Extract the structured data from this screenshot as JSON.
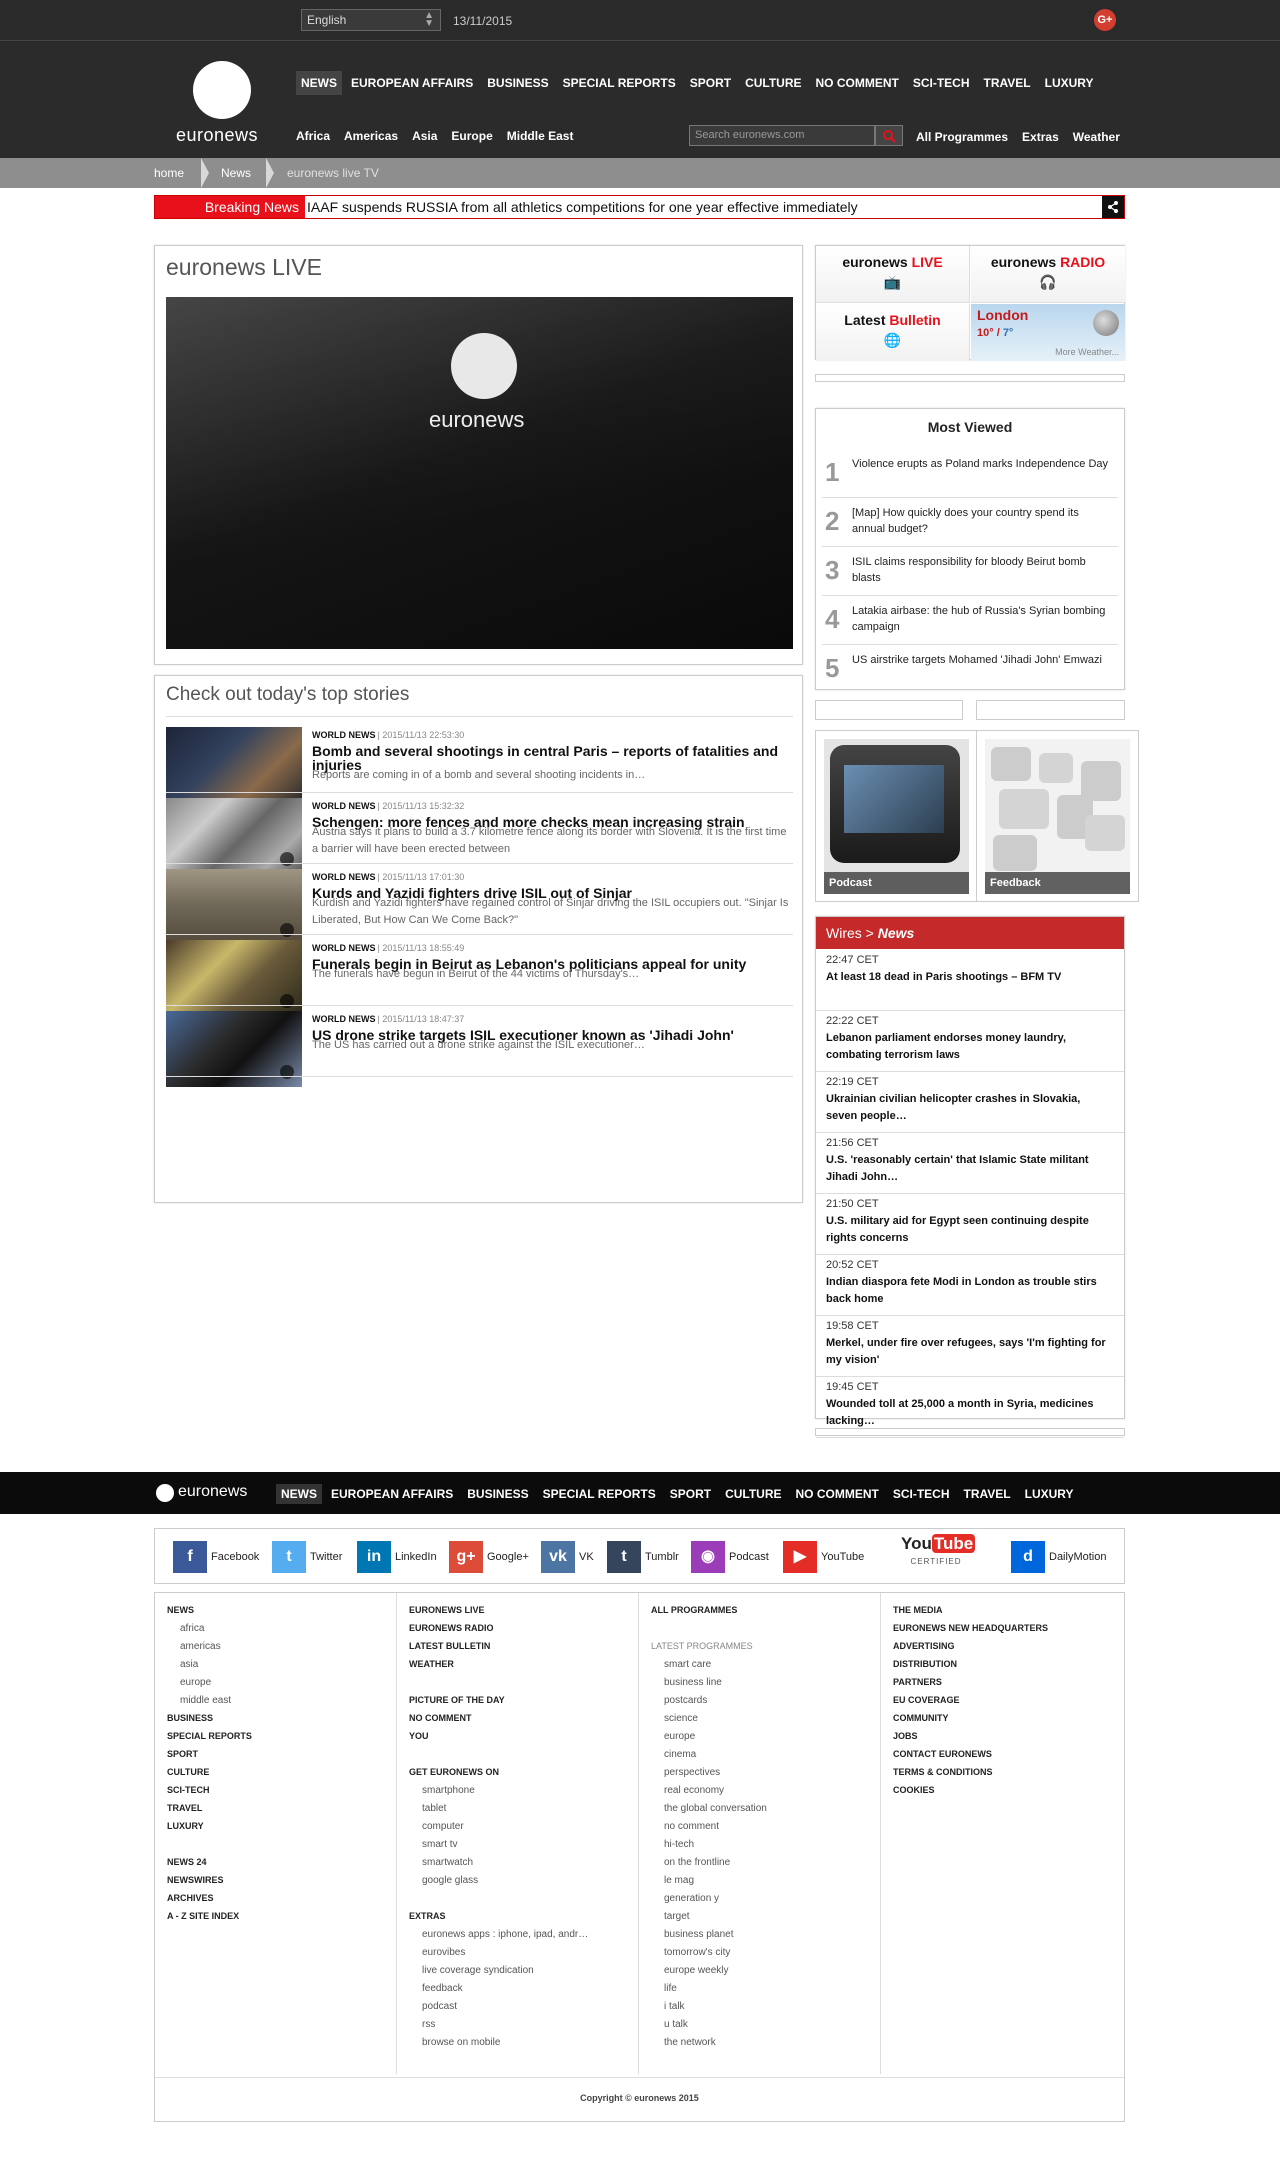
{
  "topbar": {
    "language": "English",
    "date": "13/11/2015",
    "gplus": "G+"
  },
  "logo": "euronews",
  "mainnav": [
    "NEWS",
    "EUROPEAN AFFAIRS",
    "BUSINESS",
    "SPECIAL REPORTS",
    "SPORT",
    "CULTURE",
    "NO COMMENT",
    "SCI-TECH",
    "TRAVEL",
    "LUXURY"
  ],
  "subnav": [
    "Africa",
    "Americas",
    "Asia",
    "Europe",
    "Middle East"
  ],
  "search": {
    "placeholder": "Search euronews.com"
  },
  "rightnav": [
    "All Programmes",
    "Extras",
    "Weather"
  ],
  "breadcrumb": {
    "home": "home",
    "news": "News",
    "current": "euronews live TV"
  },
  "breaking": {
    "label": "Breaking News",
    "text": "IAAF suspends RUSSIA from all athletics competitions for one year effective immediately"
  },
  "live": {
    "title": "euronews LIVE",
    "player_logo": "euronews"
  },
  "stories": {
    "title": "Check out today's top stories",
    "items": [
      {
        "cat": "WORLD NEWS",
        "time": "| 2015/11/13 22:53:30",
        "title": "Bomb and several shootings in central Paris – reports of fatalities and injuries",
        "desc": "Reports are coming in of a bomb and several shooting incidents in…"
      },
      {
        "cat": "WORLD NEWS",
        "time": "| 2015/11/13 15:32:32",
        "title": "Schengen: more fences and more checks mean increasing strain",
        "desc": "Austria says it plans to build a 3.7 kilometre fence along its border with Slovenia. It is the first time a barrier will have been erected between"
      },
      {
        "cat": "WORLD NEWS",
        "time": "| 2015/11/13 17:01:30",
        "title": "Kurds and Yazidi fighters drive ISIL out of Sinjar",
        "desc": "Kurdish and Yazidi fighters have regained control of Sinjar driving the ISIL occupiers out. \"Sinjar Is Liberated, But How Can We Come Back?\""
      },
      {
        "cat": "WORLD NEWS",
        "time": "| 2015/11/13 18:55:49",
        "title": "Funerals begin in Beirut as Lebanon's politicians appeal for unity",
        "desc": "The funerals have begun in Beirut of the 44 victims of Thursday's…"
      },
      {
        "cat": "WORLD NEWS",
        "time": "| 2015/11/13 18:47:37",
        "title": "US drone strike targets ISIL executioner known as 'Jihadi John'",
        "desc": "The US has carried out a drone strike against the ISIL executioner…"
      }
    ]
  },
  "quick": {
    "live": {
      "a": "euronews ",
      "b": "LIVE"
    },
    "radio": {
      "a": "euronews ",
      "b": "RADIO"
    },
    "bulletin": {
      "a": "Latest ",
      "b": "Bulletin"
    },
    "weather": {
      "city": "London",
      "high": "10° / ",
      "low": "7°",
      "more": "More Weather..."
    }
  },
  "mostviewed": {
    "title": "Most Viewed",
    "items": [
      {
        "n": "1",
        "t": "Violence erupts as Poland marks Independence Day"
      },
      {
        "n": "2",
        "t": "[Map] How quickly does your country spend its annual budget?"
      },
      {
        "n": "3",
        "t": "ISIL claims responsibility for bloody Beirut bomb blasts"
      },
      {
        "n": "4",
        "t": "Latakia airbase: the hub of Russia's Syrian bombing campaign"
      },
      {
        "n": "5",
        "t": "US airstrike targets Mohamed 'Jihadi John' Emwazi"
      }
    ]
  },
  "promos": {
    "podcast": "Podcast",
    "feedback": "Feedback"
  },
  "wires": {
    "head_a": "Wires > ",
    "head_b": "News",
    "items": [
      {
        "time": "22:47 CET",
        "title": "At least 18 dead in Paris shootings – BFM TV"
      },
      {
        "time": "22:22 CET",
        "title": "Lebanon parliament endorses money laundry, combating terrorism laws"
      },
      {
        "time": "22:19 CET",
        "title": "Ukrainian civilian helicopter crashes in Slovakia, seven people…"
      },
      {
        "time": "21:56 CET",
        "title": "U.S. 'reasonably certain' that Islamic State militant Jihadi John…"
      },
      {
        "time": "21:50 CET",
        "title": "U.S. military aid for Egypt seen continuing despite rights concerns"
      },
      {
        "time": "20:52 CET",
        "title": "Indian diaspora fete Modi in London as trouble stirs back home"
      },
      {
        "time": "19:58 CET",
        "title": "Merkel, under fire over refugees, says 'I'm fighting for my vision'"
      },
      {
        "time": "19:45 CET",
        "title": "Wounded toll at 25,000 a month in Syria, medicines lacking…"
      }
    ]
  },
  "footnav": [
    "NEWS",
    "EUROPEAN AFFAIRS",
    "BUSINESS",
    "SPECIAL REPORTS",
    "SPORT",
    "CULTURE",
    "NO COMMENT",
    "SCI-TECH",
    "TRAVEL",
    "LUXURY"
  ],
  "social": [
    {
      "name": "Facebook",
      "glyph": "f",
      "color": "#3b5998"
    },
    {
      "name": "Twitter",
      "glyph": "t",
      "color": "#55acee"
    },
    {
      "name": "LinkedIn",
      "glyph": "in",
      "color": "#0077b5"
    },
    {
      "name": "Google+",
      "glyph": "g+",
      "color": "#dd4b39"
    },
    {
      "name": "VK",
      "glyph": "vk",
      "color": "#4c75a3"
    },
    {
      "name": "Tumblr",
      "glyph": "t",
      "color": "#35465c"
    },
    {
      "name": "Podcast",
      "glyph": "◉",
      "color": "#9b3db8"
    },
    {
      "name": "YouTube",
      "glyph": "▶",
      "color": "#e52d27"
    },
    {
      "name": "DailyMotion",
      "glyph": "d",
      "color": "#0066dc"
    }
  ],
  "youtube_certified": {
    "a": "You",
    "b": "Tube",
    "c": "CERTIFIED"
  },
  "sitemap": {
    "col1": [
      "NEWS",
      "africa",
      "americas",
      "asia",
      "europe",
      "middle east",
      "BUSINESS",
      "SPECIAL REPORTS",
      "SPORT",
      "CULTURE",
      "SCI-TECH",
      "TRAVEL",
      "LUXURY",
      "NEWS 24",
      "NEWSWIRES",
      "ARCHIVES",
      "A - Z SITE INDEX"
    ],
    "col2": [
      "EURONEWS LIVE",
      "EURONEWS RADIO",
      "LATEST BULLETIN",
      "WEATHER",
      "PICTURE OF THE DAY",
      "NO COMMENT",
      "YOU",
      "GET EURONEWS ON",
      "smartphone",
      "tablet",
      "computer",
      "smart tv",
      "smartwatch",
      "google glass",
      "EXTRAS",
      "euronews apps : iphone, ipad, andr…",
      "eurovibes",
      "live coverage syndication",
      "feedback",
      "podcast",
      "rss",
      "browse on mobile"
    ],
    "col3": [
      "ALL PROGRAMMES",
      "LATEST PROGRAMMES",
      "smart care",
      "business line",
      "postcards",
      "science",
      "europe",
      "cinema",
      "perspectives",
      "real economy",
      "the global conversation",
      "no comment",
      "hi-tech",
      "on the frontline",
      "le mag",
      "generation y",
      "target",
      "business planet",
      "tomorrow's city",
      "europe weekly",
      "life",
      "i talk",
      "u talk",
      "the network"
    ],
    "col4": [
      "THE MEDIA",
      "EURONEWS NEW HEADQUARTERS",
      "ADVERTISING",
      "DISTRIBUTION",
      "PARTNERS",
      "EU COVERAGE",
      "COMMUNITY",
      "JOBS",
      "CONTACT EURONEWS",
      "TERMS & CONDITIONS",
      "COOKIES"
    ]
  },
  "copyright": "Copyright © euronews 2015"
}
